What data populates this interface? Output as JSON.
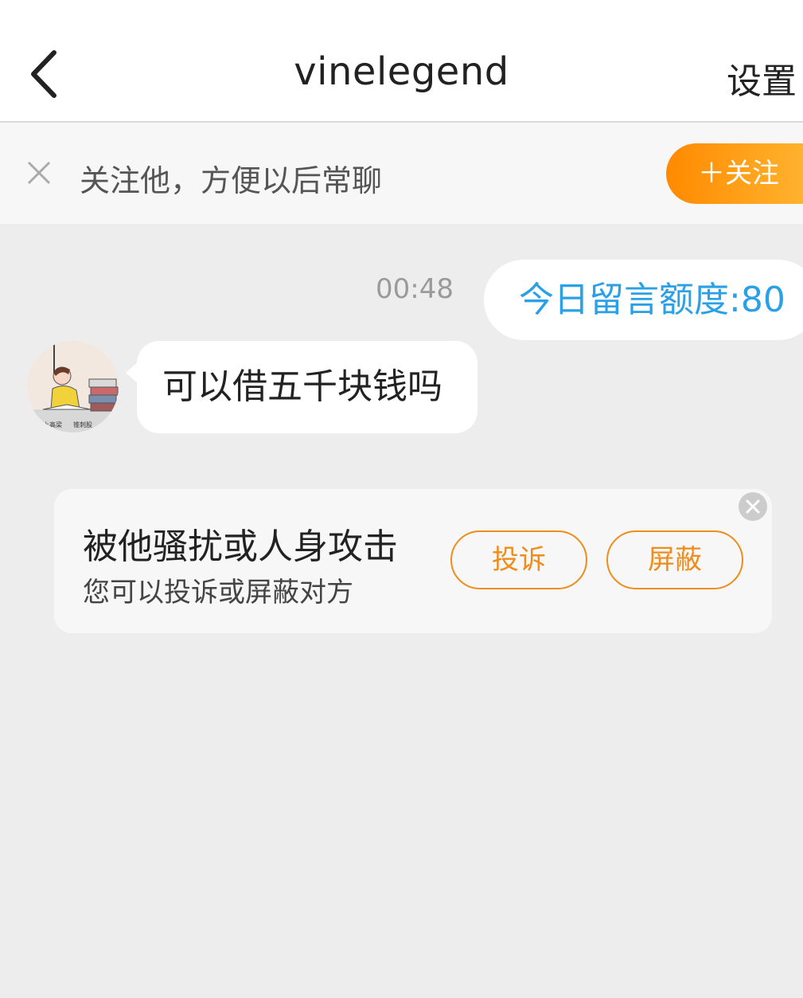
{
  "header": {
    "title": "vinelegend",
    "settings_label": "设置"
  },
  "follow_bar": {
    "prompt": "关注他，方便以后常聊",
    "follow_label": "＋关注"
  },
  "messages": {
    "time": "00:48",
    "outgoing": "今日留言额度:80",
    "incoming": "可以借五千块钱吗"
  },
  "notice": {
    "title": "被他骚扰或人身攻击",
    "subtitle": "您可以投诉或屏蔽对方",
    "report_label": "投诉",
    "block_label": "屏蔽"
  },
  "avatar": {
    "caption_left": "上高梁",
    "caption_right": "锥刺股"
  },
  "colors": {
    "accent_orange": "#f08c1a",
    "link_blue": "#2aa0e6"
  }
}
